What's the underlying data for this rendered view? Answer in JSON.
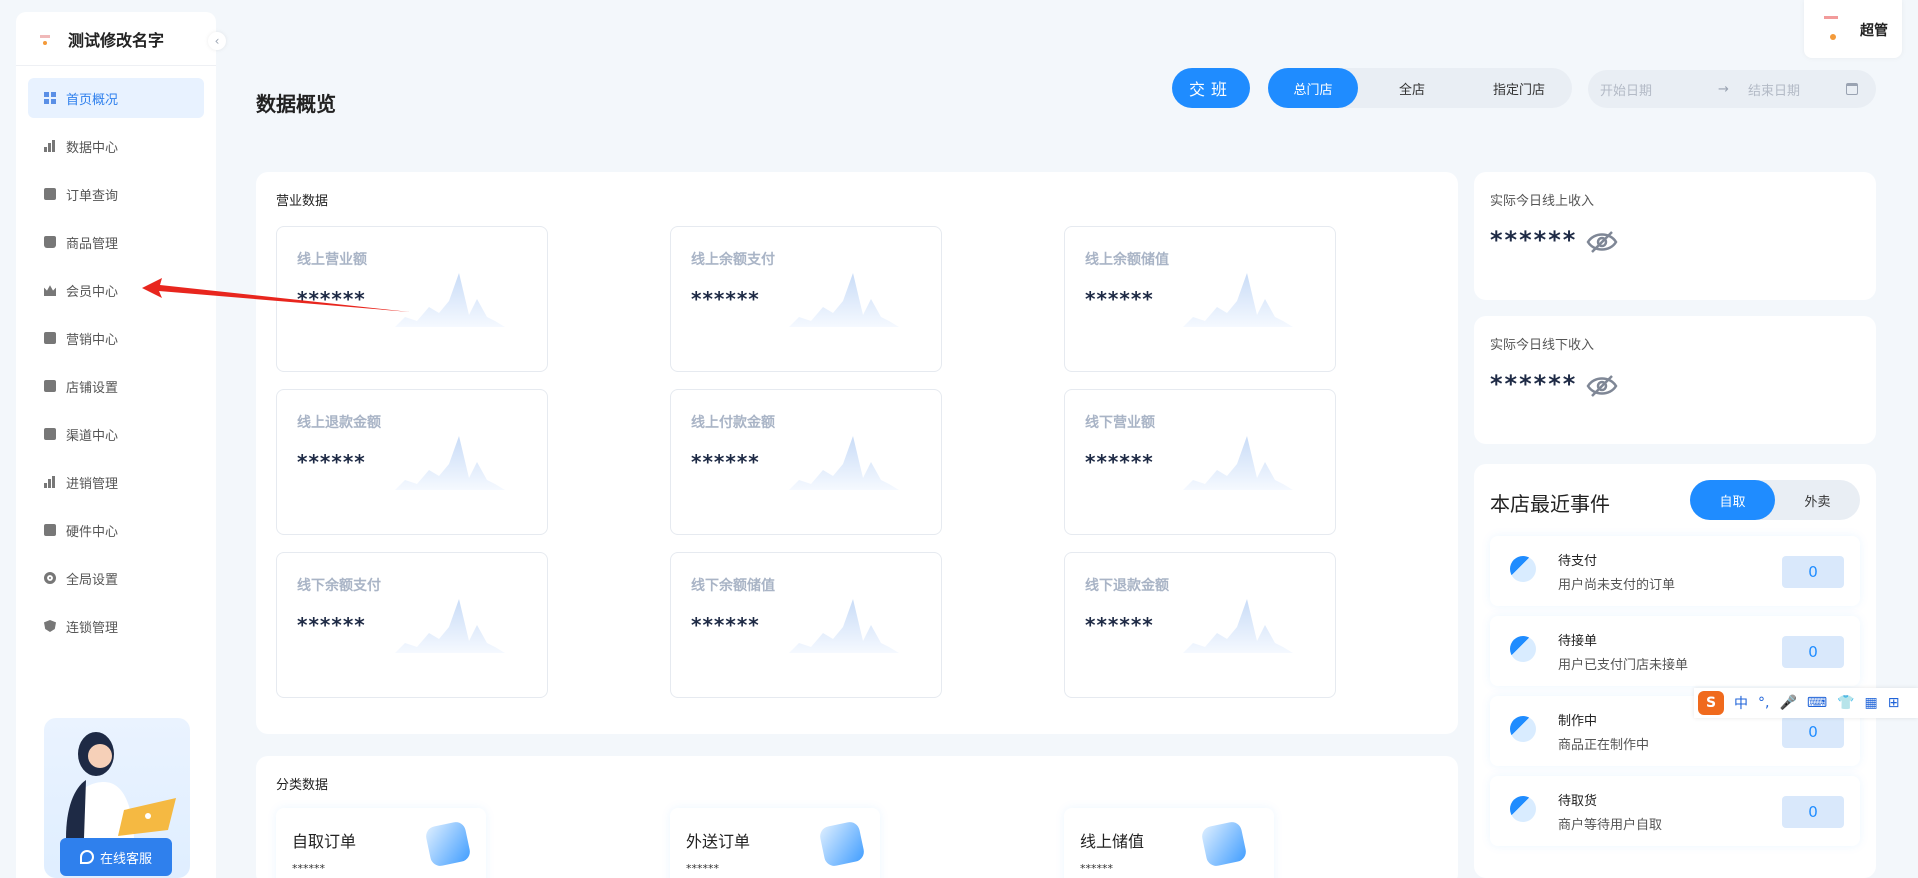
{
  "brand": {
    "title": "测试修改名字"
  },
  "sidebar": {
    "items": [
      {
        "label": "首页概况",
        "icon": "dashboard-icon",
        "active": true
      },
      {
        "label": "数据中心",
        "icon": "bar-chart-icon"
      },
      {
        "label": "订单查询",
        "icon": "order-icon"
      },
      {
        "label": "商品管理",
        "icon": "bag-icon"
      },
      {
        "label": "会员中心",
        "icon": "crown-icon"
      },
      {
        "label": "营销中心",
        "icon": "marketing-icon"
      },
      {
        "label": "店铺设置",
        "icon": "store-icon"
      },
      {
        "label": "渠道中心",
        "icon": "channel-icon"
      },
      {
        "label": "进销管理",
        "icon": "inventory-icon"
      },
      {
        "label": "硬件中心",
        "icon": "hardware-icon"
      },
      {
        "label": "全局设置",
        "icon": "gear-icon"
      },
      {
        "label": "连锁管理",
        "icon": "shield-icon"
      }
    ],
    "support_label": "在线客服"
  },
  "header": {
    "page_title": "数据概览",
    "shift_button": "交班",
    "store_tabs": [
      {
        "label": "总门店",
        "active": true
      },
      {
        "label": "全店"
      },
      {
        "label": "指定门店"
      }
    ],
    "date_start_placeholder": "开始日期",
    "date_end_placeholder": "结束日期",
    "date_separator": "→",
    "user_name": "超管"
  },
  "business": {
    "title": "营业数据",
    "metrics": [
      {
        "label": "线上营业额",
        "value": "******"
      },
      {
        "label": "线上余额支付",
        "value": "******"
      },
      {
        "label": "线上余额储值",
        "value": "******"
      },
      {
        "label": "线上退款金额",
        "value": "******"
      },
      {
        "label": "线上付款金额",
        "value": "******"
      },
      {
        "label": "线下营业额",
        "value": "******"
      },
      {
        "label": "线下余额支付",
        "value": "******"
      },
      {
        "label": "线下余额储值",
        "value": "******"
      },
      {
        "label": "线下退款金额",
        "value": "******"
      }
    ]
  },
  "category": {
    "title": "分类数据",
    "cards": [
      {
        "label": "自取订单",
        "value": "******"
      },
      {
        "label": "外送订单",
        "value": "******"
      },
      {
        "label": "线上储值",
        "value": "******"
      }
    ]
  },
  "income": {
    "online": {
      "label": "实际今日线上收入",
      "value": "******"
    },
    "offline": {
      "label": "实际今日线下收入",
      "value": "******"
    }
  },
  "events": {
    "title": "本店最近事件",
    "tabs": [
      {
        "label": "自取",
        "active": true
      },
      {
        "label": "外卖"
      }
    ],
    "items": [
      {
        "name": "待支付",
        "desc": "用户尚未支付的订单",
        "count": "0"
      },
      {
        "name": "待接单",
        "desc": "用户已支付门店未接单",
        "count": "0"
      },
      {
        "name": "制作中",
        "desc": "商品正在制作中",
        "count": "0"
      },
      {
        "name": "待取货",
        "desc": "商户等待用户自取",
        "count": "0"
      }
    ]
  },
  "ime": {
    "logo": "S",
    "mode": "中",
    "punct": "°,"
  },
  "colors": {
    "accent": "#1f8cff",
    "annotation_arrow": "#e8261e"
  }
}
